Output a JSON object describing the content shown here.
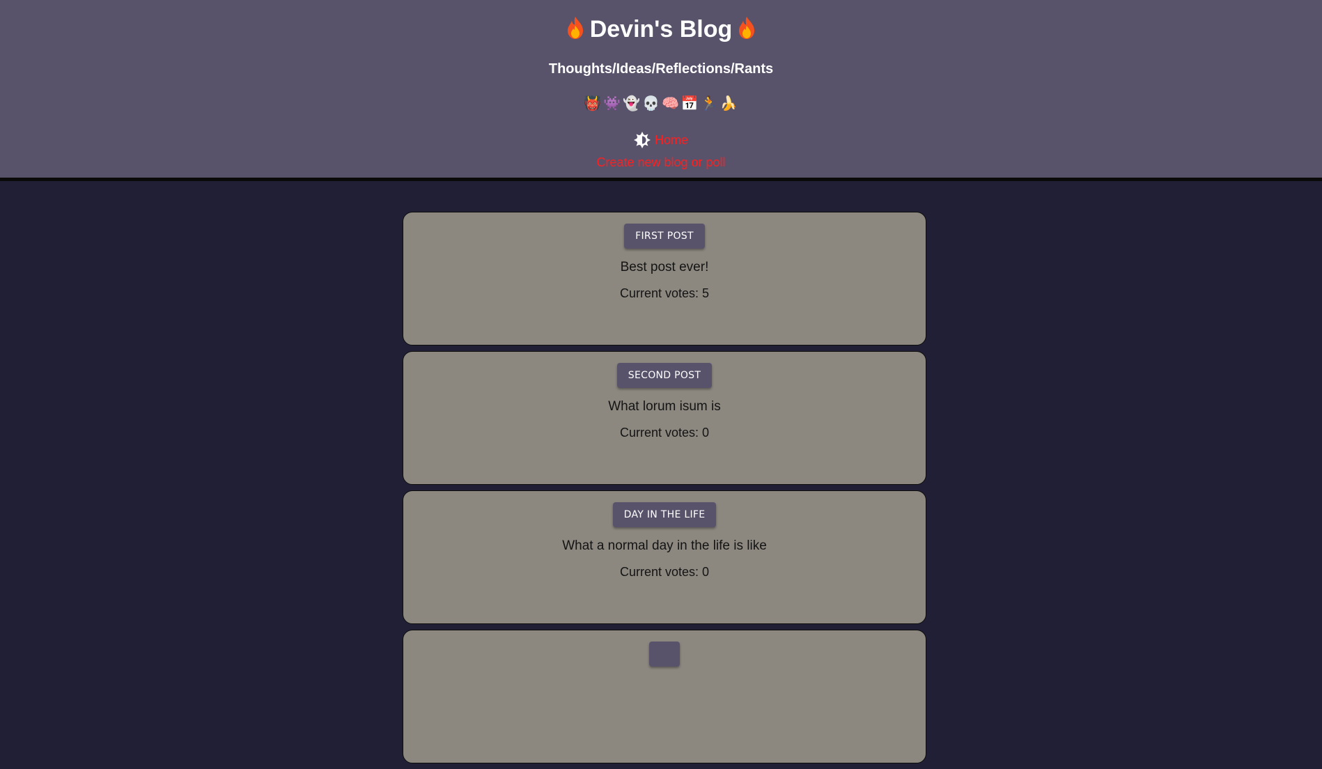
{
  "header": {
    "title": "Devin's Blog",
    "subtitle": "Thoughts/Ideas/Reflections/Rants",
    "emojis": [
      "👹",
      "👾",
      "👻",
      "💀",
      "🧠",
      "📅",
      "🏃",
      "🍌"
    ],
    "nav": {
      "home_label": "Home",
      "create_label": "Create new blog or poll"
    }
  },
  "posts": [
    {
      "button_label": "FIRST POST",
      "description": "Best post ever!",
      "votes": "Current votes: 5"
    },
    {
      "button_label": "SECOND POST",
      "description": "What lorum isum is",
      "votes": "Current votes: 0"
    },
    {
      "button_label": "DAY IN THE LIFE",
      "description": "What a normal day in the life is like",
      "votes": "Current votes: 0"
    },
    {
      "button_label": "",
      "description": "",
      "votes": ""
    }
  ],
  "colors": {
    "header_bg": "#58536b",
    "page_bg": "#211f35",
    "card_bg": "#8c8880",
    "link": "#ff1f1f"
  }
}
